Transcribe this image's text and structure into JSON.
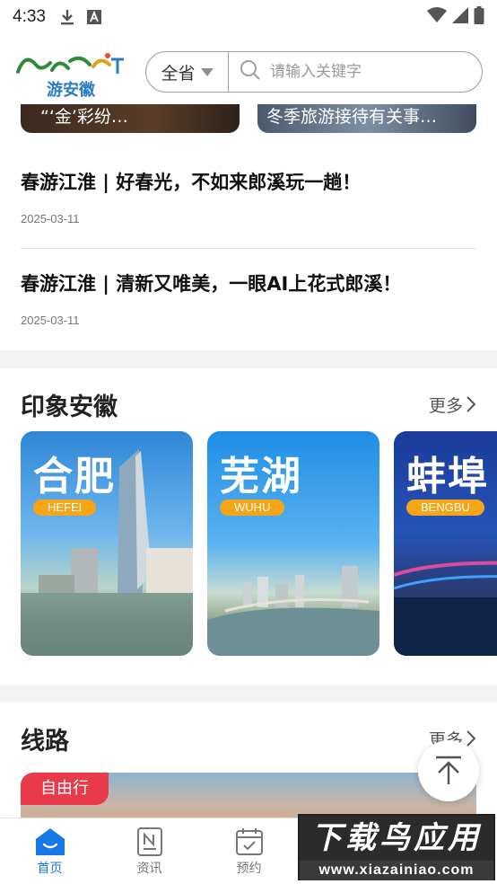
{
  "status_bar": {
    "time": "4:33"
  },
  "header": {
    "logo_en": "Anhui",
    "logo_cn": "游安徽",
    "region": "全省",
    "search_placeholder": "请输入关键字"
  },
  "top_cards": [
    {
      "text": "“‘金’彩纷…"
    },
    {
      "text": "冬季旅游接待有关事…"
    }
  ],
  "news": [
    {
      "title": "春游江淮 | 好春光，不如来郎溪玩一趟！",
      "date": "2025-03-11"
    },
    {
      "title": "春游江淮 | 清新又唯美，一眼AI上花式郎溪！",
      "date": "2025-03-11"
    }
  ],
  "impression": {
    "title": "印象安徽",
    "more": "更多",
    "cities": [
      {
        "cn": "合肥",
        "en": "HEFEI"
      },
      {
        "cn": "芜湖",
        "en": "WUHU"
      },
      {
        "cn": "蚌埠",
        "en": "BENGBU"
      }
    ]
  },
  "routes": {
    "title": "线路",
    "more": "更多",
    "tag": "自由行"
  },
  "tabs": [
    {
      "label": "首页",
      "icon": "home-icon",
      "active": true
    },
    {
      "label": "资讯",
      "icon": "news-icon",
      "active": false
    },
    {
      "label": "预约",
      "icon": "calendar-icon",
      "active": false
    }
  ],
  "watermark": {
    "top": "下载鸟应用",
    "bottom": "www.xiazainiao.com"
  },
  "colors": {
    "accent": "#1677e6",
    "tag_red": "#e83a4a",
    "badge_orange": "#f5a515"
  }
}
